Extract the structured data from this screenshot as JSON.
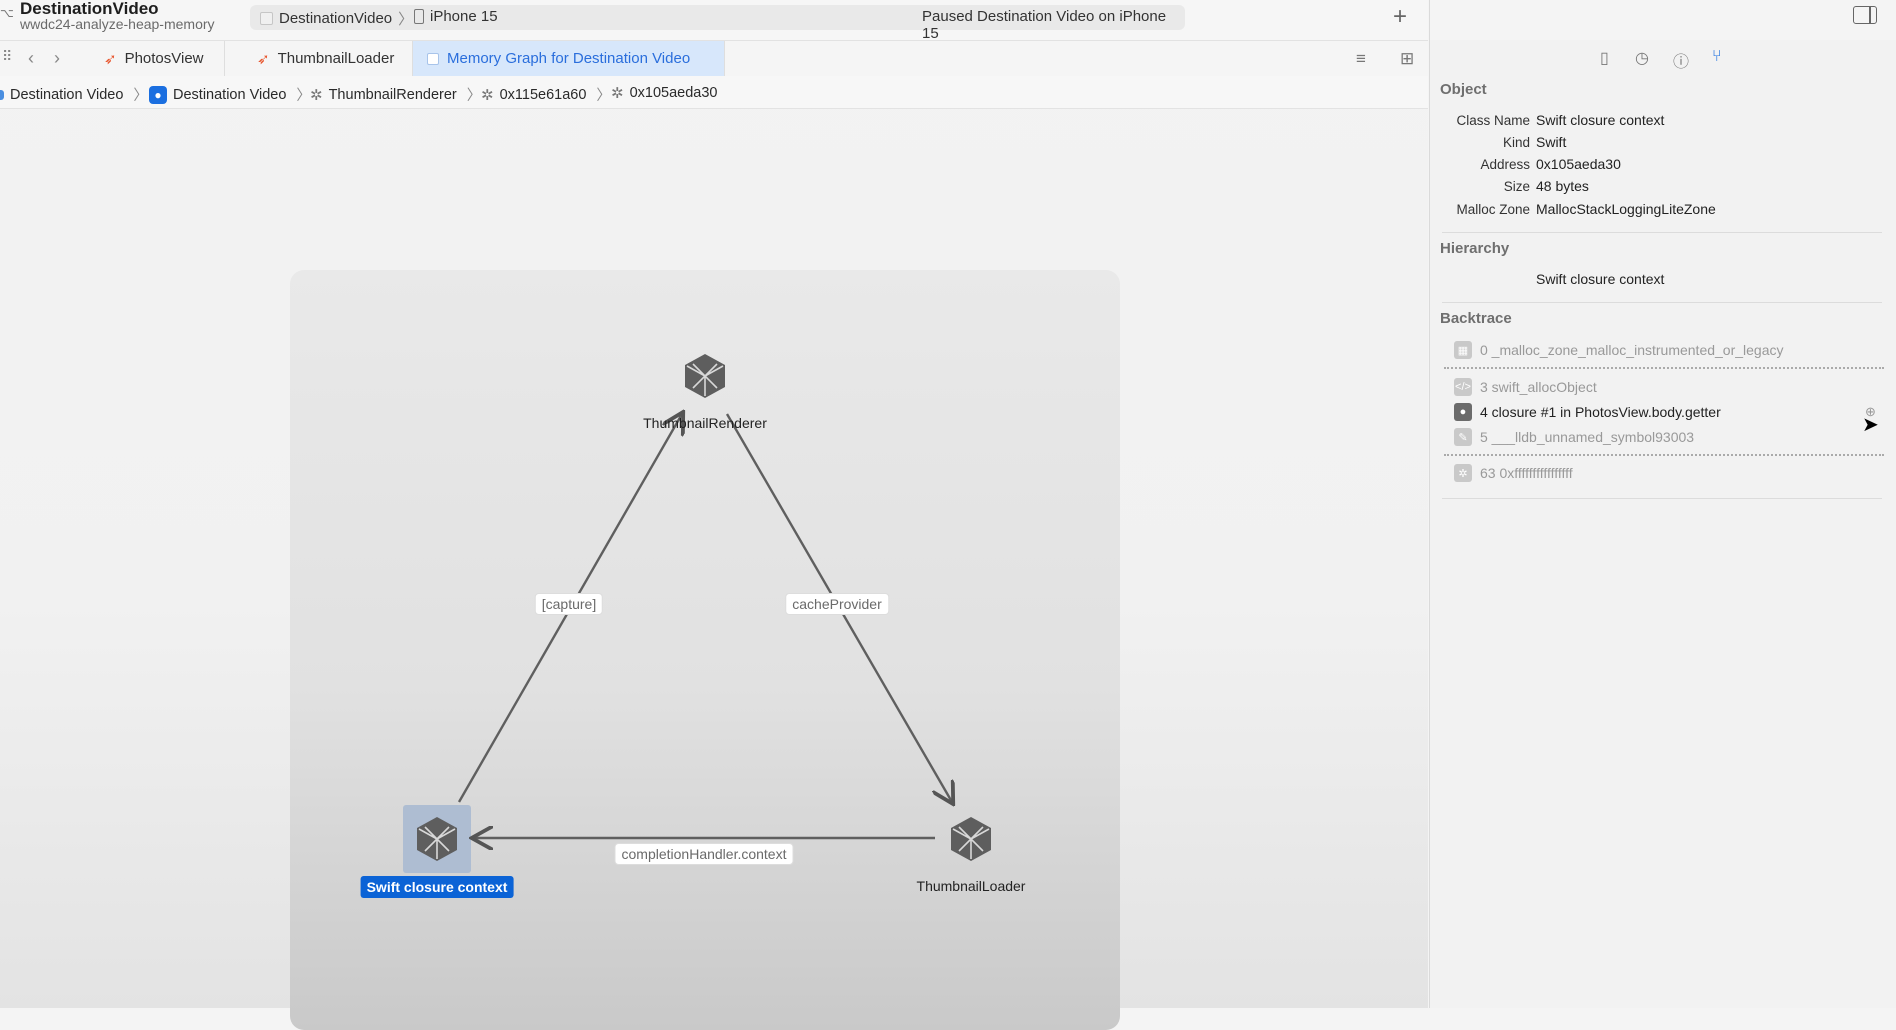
{
  "project": {
    "title": "DestinationVideo",
    "subtitle": "wwdc24-analyze-heap-memory"
  },
  "scheme": {
    "target": "DestinationVideo",
    "device": "iPhone 15",
    "status": "Paused Destination Video on iPhone 15"
  },
  "tabs": [
    {
      "label": "PhotosView",
      "icon": "swift-file-icon"
    },
    {
      "label": "ThumbnailLoader",
      "icon": "swift-file-icon"
    },
    {
      "label": "Memory Graph for Destination Video",
      "icon": "memory-graph-icon"
    }
  ],
  "breadcrumb": [
    "Destination Video",
    "Destination Video",
    "ThumbnailRenderer",
    "0x115e61a60",
    "0x105aeda30"
  ],
  "graph": {
    "nodes": {
      "renderer": "ThumbnailRenderer",
      "closure": "Swift closure context",
      "loader": "ThumbnailLoader"
    },
    "edges": {
      "capture": "[capture]",
      "cache": "cacheProvider",
      "completion": "completionHandler.context"
    }
  },
  "inspector": {
    "object_header": "Object",
    "object": {
      "class_name_label": "Class Name",
      "class_name": "Swift closure context",
      "kind_label": "Kind",
      "kind": "Swift",
      "address_label": "Address",
      "address": "0x105aeda30",
      "size_label": "Size",
      "size": "48 bytes",
      "zone_label": "Malloc Zone",
      "zone": "MallocStackLoggingLiteZone"
    },
    "hierarchy_header": "Hierarchy",
    "hierarchy": "Swift closure context",
    "backtrace_header": "Backtrace",
    "backtrace": [
      "0 _malloc_zone_malloc_instrumented_or_legacy",
      "3 swift_allocObject",
      "4 closure #1 in PhotosView.body.getter",
      "5 ___lldb_unnamed_symbol93003",
      "63 0xffffffffffffffff"
    ]
  }
}
